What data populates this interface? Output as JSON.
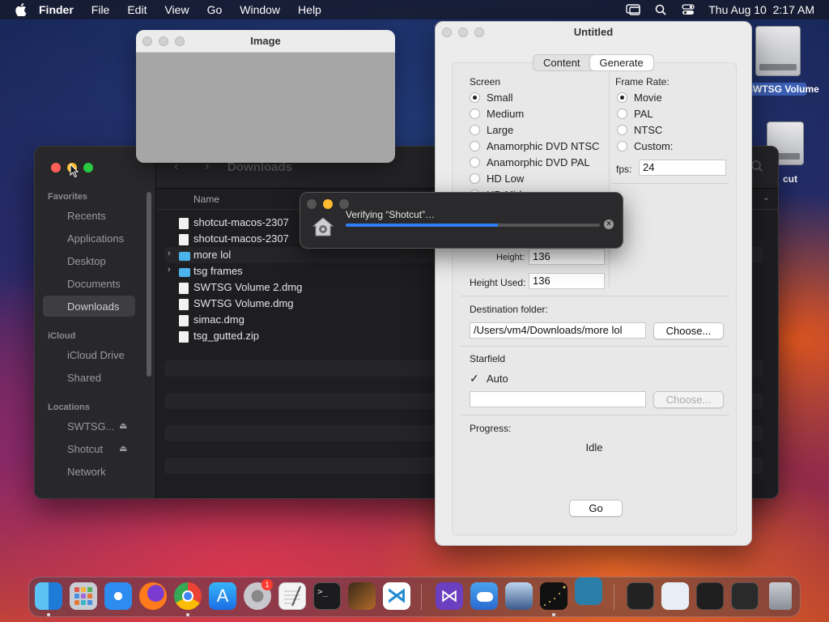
{
  "menubar": {
    "app": "Finder",
    "items": [
      "File",
      "Edit",
      "View",
      "Go",
      "Window",
      "Help"
    ],
    "clock": "Thu Aug 10  2:17 AM"
  },
  "desktop": {
    "icons": [
      {
        "label": "SWTSG Volume"
      },
      {
        "label": "cut"
      }
    ]
  },
  "image_window": {
    "title": "Image"
  },
  "finder": {
    "location": "Downloads",
    "column_name": "Name",
    "sidebar": {
      "favorites_header": "Favorites",
      "favorites": [
        "Recents",
        "Applications",
        "Desktop",
        "Documents",
        "Downloads"
      ],
      "icloud_header": "iCloud",
      "icloud": [
        "iCloud Drive",
        "Shared"
      ],
      "locations_header": "Locations",
      "locations": [
        "SWTSG...",
        "Shotcut",
        "Network"
      ]
    },
    "files": [
      {
        "name": "shotcut-macos-2307",
        "kind": "doc"
      },
      {
        "name": "shotcut-macos-2307",
        "kind": "doc"
      },
      {
        "name": "more lol",
        "kind": "folder"
      },
      {
        "name": "tsg frames",
        "kind": "folder"
      },
      {
        "name": "SWTSG Volume 2.dmg",
        "kind": "doc"
      },
      {
        "name": "SWTSG Volume.dmg",
        "kind": "doc"
      },
      {
        "name": "simac.dmg",
        "kind": "doc"
      },
      {
        "name": "tsg_gutted.zip",
        "kind": "doc"
      }
    ]
  },
  "verify": {
    "message": "Verifying “Shotcut”…",
    "progress": 0.6
  },
  "untitled": {
    "title": "Untitled",
    "tabs": [
      "Content",
      "Generate"
    ],
    "active_tab": "Generate",
    "screen_label": "Screen",
    "screen_options": [
      "Small",
      "Medium",
      "Large",
      "Anamorphic DVD NTSC",
      "Anamorphic DVD PAL",
      "HD Low",
      "HD Mid"
    ],
    "frame_rate_label": "Frame Rate:",
    "frame_rate_options": [
      "Movie",
      "PAL",
      "NTSC",
      "Custom:"
    ],
    "fps_label": "fps:",
    "fps_value": "24",
    "height_label": "Height:",
    "height_value": "136",
    "height_used_label": "Height Used:",
    "height_used_value": "136",
    "destination_label": "Destination folder:",
    "destination_value": "/Users/vm4/Downloads/more lol",
    "choose_label": "Choose...",
    "starfield_label": "Starfield",
    "auto_label": "Auto",
    "starfield_value": "",
    "starfield_choose_label": "Choose...",
    "progress_label": "Progress:",
    "progress_status": "Idle",
    "go_label": "Go"
  },
  "dock": {
    "notification_badge": "1"
  }
}
